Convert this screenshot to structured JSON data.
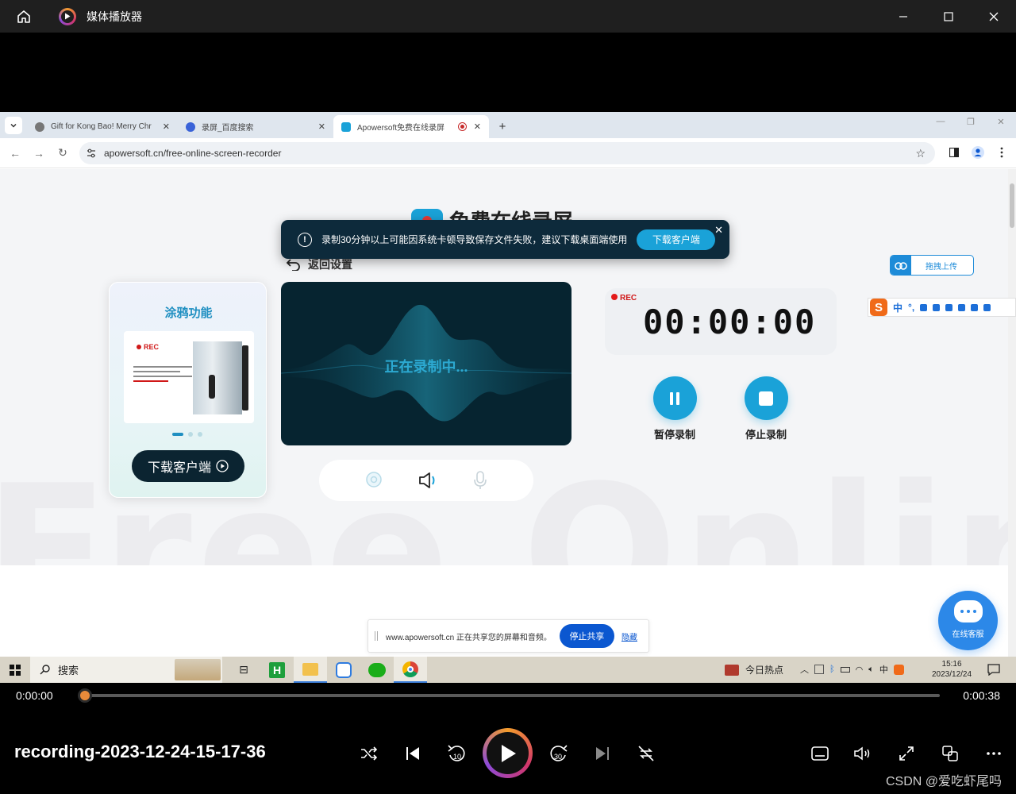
{
  "player": {
    "app_title": "媒体播放器",
    "current_time": "0:00:00",
    "total_time": "0:00:38",
    "progress": 0.0,
    "file_name": "recording-2023-12-24-15-17-36",
    "watermark": "CSDN @爱吃虾尾吗",
    "accent_colors": [
      "#f39c2c",
      "#d2366b",
      "#8d4bd8"
    ]
  },
  "browser": {
    "tabs": [
      {
        "label": "Gift for Kong Bao! Merry Chr",
        "favicon": "globe-icon",
        "active": false
      },
      {
        "label": "录屏_百度搜索",
        "favicon": "baidu-paw-icon",
        "active": false
      },
      {
        "label": "Apowersoft免费在线录屏",
        "favicon": "apowersoft-icon",
        "active": true,
        "recording": true
      }
    ],
    "url": "apowersoft.cn/free-online-screen-recorder"
  },
  "webpage": {
    "heading": "免费在线录屏",
    "bg_watermark": "Free Online",
    "notice": {
      "message": "录制30分钟以上可能因系统卡顿导致保存文件失败，建议下载桌面端使用",
      "button": "下载客户端"
    },
    "back_label": "返回设置",
    "card": {
      "title": "涂鸦功能",
      "rec_label": "REC",
      "download_button": "下载客户端"
    },
    "recording_status": "正在录制中...",
    "timer": {
      "rec_label": "REC",
      "time": "00:00:00"
    },
    "pause_label": "暂停录制",
    "stop_label": "停止录制",
    "upload_label": "拖拽上传",
    "ime_lang": "中",
    "kefu_label": "在线客服",
    "share": {
      "text": "www.apowersoft.cn 正在共享您的屏幕和音频。",
      "stop": "停止共享",
      "hide": "隐藏"
    }
  },
  "taskbar": {
    "search": "搜索",
    "news": "今日热点",
    "ime": "中",
    "time": "15:16",
    "date": "2023/12/24"
  }
}
